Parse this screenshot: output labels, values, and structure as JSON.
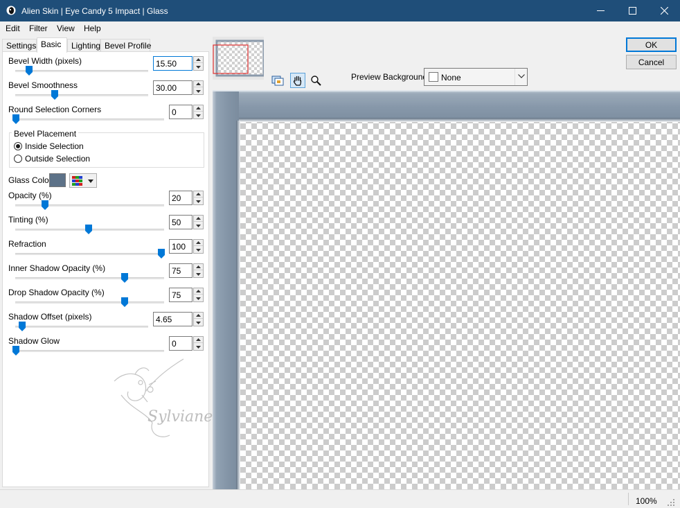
{
  "window": {
    "title": "Alien Skin | Eye Candy 5 Impact | Glass",
    "titlebar_color": "#1f4e79"
  },
  "menu": [
    "Edit",
    "Filter",
    "View",
    "Help"
  ],
  "tabs": [
    "Settings",
    "Basic",
    "Lighting",
    "Bevel Profile"
  ],
  "active_tab": "Basic",
  "controls": {
    "bevel_width": {
      "label": "Bevel Width (pixels)",
      "value": "15.50",
      "position": 0.15
    },
    "bevel_smoothness": {
      "label": "Bevel Smoothness",
      "value": "30.00",
      "position": 0.3
    },
    "round_corners": {
      "label": "Round Selection Corners",
      "value": "0",
      "position": 0.0
    },
    "bevel_placement": {
      "title": "Bevel Placement",
      "options": [
        "Inside Selection",
        "Outside Selection"
      ],
      "selected": "Inside Selection"
    },
    "glass_color": {
      "label": "Glass Color",
      "color": "#5d7288"
    },
    "opacity": {
      "label": "Opacity (%)",
      "value": "20",
      "position": 0.2
    },
    "tinting": {
      "label": "Tinting (%)",
      "value": "50",
      "position": 0.5
    },
    "refraction": {
      "label": "Refraction",
      "value": "100",
      "position": 1.0
    },
    "inner_shadow": {
      "label": "Inner Shadow Opacity (%)",
      "value": "75",
      "position": 0.75
    },
    "drop_shadow": {
      "label": "Drop Shadow Opacity (%)",
      "value": "75",
      "position": 0.75
    },
    "shadow_offset": {
      "label": "Shadow Offset (pixels)",
      "value": "4.65",
      "position": 0.05
    },
    "shadow_glow": {
      "label": "Shadow Glow",
      "value": "0",
      "position": 0.0
    }
  },
  "preview_background": {
    "label": "Preview Background:",
    "value": "None"
  },
  "buttons": {
    "ok": "OK",
    "cancel": "Cancel"
  },
  "status": {
    "zoom": "100%"
  },
  "watermark_text": "Sylviane",
  "icons": [
    "app-logo-icon",
    "minimize-icon",
    "maximize-icon",
    "close-icon",
    "navigate-icon",
    "hand-icon",
    "zoom-icon",
    "chevron-down-icon",
    "resize-grip-icon"
  ]
}
